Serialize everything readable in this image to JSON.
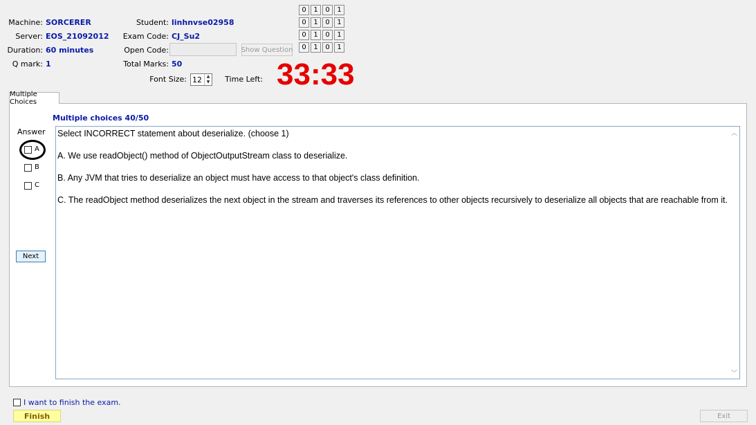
{
  "header": {
    "machine_label": "Machine:",
    "machine_value": "SORCERER",
    "server_label": "Server:",
    "server_value": "EOS_21092012",
    "duration_label": "Duration:",
    "duration_value": "60 minutes",
    "qmark_label": "Q mark:",
    "qmark_value": "1",
    "student_label": "Student:",
    "student_value": "linhnvse02958",
    "exam_code_label": "Exam Code:",
    "exam_code_value": "CJ_Su2",
    "open_code_label": "Open Code:",
    "open_code_value": "",
    "show_question_label": "Show Question",
    "total_marks_label": "Total Marks:",
    "total_marks_value": "50",
    "font_size_label": "Font Size:",
    "font_size_value": "12",
    "time_left_label": "Time Left:",
    "time_left_value": "33:33"
  },
  "bit_grid": [
    [
      "0",
      "1",
      "0",
      "1"
    ],
    [
      "0",
      "1",
      "0",
      "1"
    ],
    [
      "0",
      "1",
      "0",
      "1"
    ],
    [
      "0",
      "1",
      "0",
      "1"
    ]
  ],
  "tab": {
    "label": "Multiple Choices"
  },
  "question": {
    "heading": "Multiple choices 40/50",
    "prompt": "Select INCORRECT statement about deserialize. (choose 1)",
    "options": [
      "A.  We use readObject() method of ObjectOutputStream class to deserialize.",
      "B.  Any JVM that tries to deserialize an object must have access to that object's class definition.",
      "C.  The readObject method deserializes the next object in the stream and traverses its references to other objects recursively to deserialize all objects that are reachable from it."
    ]
  },
  "answer": {
    "label": "Answer",
    "choices": [
      "A",
      "B",
      "C"
    ],
    "next_label": "Next"
  },
  "footer": {
    "finish_checkbox_label": "I want to finish the exam.",
    "finish_label": "Finish",
    "exit_label": "Exit"
  }
}
